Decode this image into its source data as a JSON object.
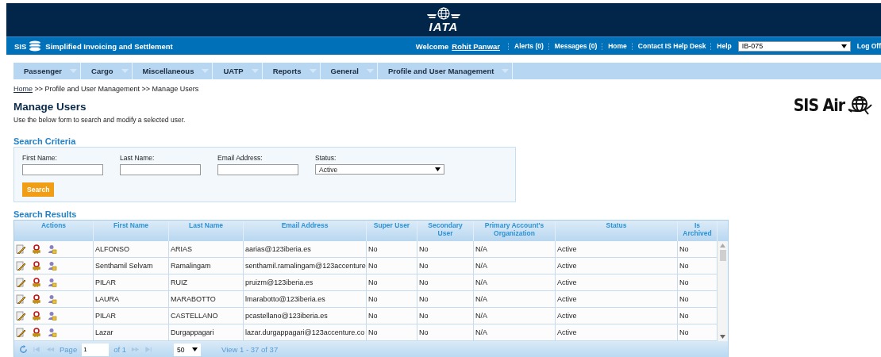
{
  "header": {
    "logo_text": "IATA"
  },
  "top_bar": {
    "brand": "SIS",
    "app_title": "Simplified Invoicing and Settlement",
    "welcome": "Welcome",
    "user": "Rohit Panwar",
    "links": [
      "Alerts (0)",
      "Messages (0)",
      "Home",
      "Contact IS Help Desk",
      "Help"
    ],
    "account": "IB-075",
    "logoff": "Log Off"
  },
  "menu": [
    "Passenger",
    "Cargo",
    "Miscellaneous",
    "UATP",
    "Reports",
    "General",
    "Profile and User Management"
  ],
  "breadcrumb": {
    "home": "Home",
    "rest": ">> Profile and User Management >> Manage Users"
  },
  "page_title": "Manage Users",
  "description": "Use the below form to search and modify a selected user.",
  "side_logo": "SIS Air",
  "search_criteria": {
    "title": "Search Criteria",
    "fields": [
      {
        "label": "First Name:",
        "kind": "text"
      },
      {
        "label": "Last Name:",
        "kind": "text"
      },
      {
        "label": "Email Address:",
        "kind": "text"
      },
      {
        "label": "Status:",
        "kind": "select",
        "value": "Active"
      }
    ],
    "button": "Search"
  },
  "search_results": {
    "title": "Search Results",
    "columns": [
      "Actions",
      "First Name",
      "Last Name",
      "Email Address",
      "Super User",
      "Secondary User",
      "Primary Account's Organization",
      "Status",
      "Is Archived"
    ],
    "rows": [
      {
        "first_name": "ALFONSO",
        "last_name": "ARIAS",
        "email": "aarias@123iberia.es",
        "super_user": "No",
        "secondary_user": "No",
        "primary_org": "N/A",
        "status": "Active",
        "is_archived": "No"
      },
      {
        "first_name": "Senthamil Selvam",
        "last_name": "Ramalingam",
        "email": "senthamil.ramalingam@123accenture",
        "super_user": "No",
        "secondary_user": "No",
        "primary_org": "N/A",
        "status": "Active",
        "is_archived": "No"
      },
      {
        "first_name": "PILAR",
        "last_name": "RUIZ",
        "email": "pruizm@123iberia.es",
        "super_user": "No",
        "secondary_user": "No",
        "primary_org": "N/A",
        "status": "Active",
        "is_archived": "No"
      },
      {
        "first_name": "LAURA",
        "last_name": "MARABOTTO",
        "email": "lmarabotto@123iberia.es",
        "super_user": "No",
        "secondary_user": "No",
        "primary_org": "N/A",
        "status": "Active",
        "is_archived": "No"
      },
      {
        "first_name": "PILAR",
        "last_name": "CASTELLANO",
        "email": "pcastellano@123iberia.es",
        "super_user": "No",
        "secondary_user": "No",
        "primary_org": "N/A",
        "status": "Active",
        "is_archived": "No"
      },
      {
        "first_name": "Lazar",
        "last_name": "Durgappagari",
        "email": "lazar.durgappagari@123accenture.co",
        "super_user": "No",
        "secondary_user": "No",
        "primary_org": "N/A",
        "status": "Active",
        "is_archived": "No"
      }
    ],
    "pager": {
      "page_label": "Page",
      "page": "1",
      "of": "of 1",
      "page_size": "50",
      "view": "View 1 - 37 of 37"
    }
  }
}
